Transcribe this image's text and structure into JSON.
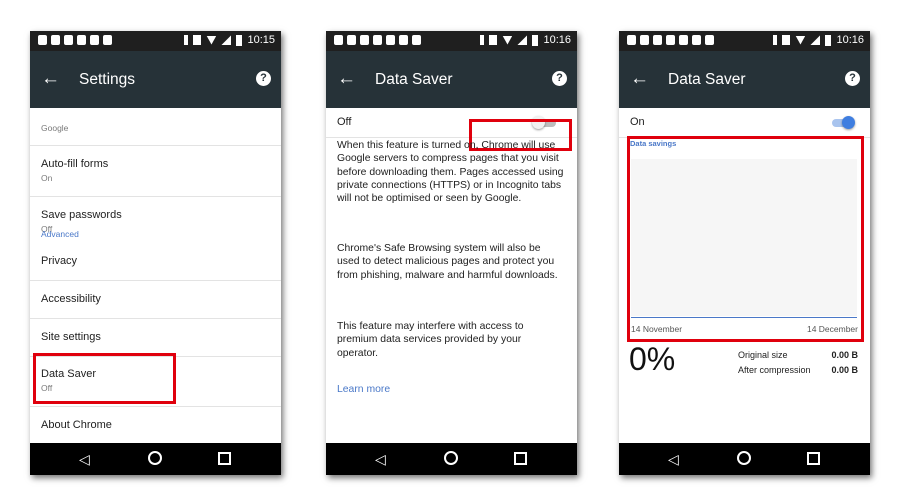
{
  "status": {
    "time1": "10:15",
    "time2": "10:16",
    "time3": "10:16"
  },
  "settings": {
    "title": "Settings",
    "partial_sub": "Google",
    "items": [
      {
        "label": "Auto-fill forms",
        "sub": "On"
      },
      {
        "label": "Save passwords",
        "sub": "Off"
      },
      {
        "label": "Privacy"
      },
      {
        "label": "Accessibility"
      },
      {
        "label": "Site settings"
      },
      {
        "label": "Data Saver",
        "sub": "Off"
      },
      {
        "label": "About Chrome"
      }
    ],
    "section": "Advanced"
  },
  "data_saver_off": {
    "title": "Data Saver",
    "toggle_label": "Off",
    "para1": "When this feature is turned on, Chrome will use Google servers to compress pages that you visit before downloading them. Pages accessed using private connections (HTTPS) or in Incognito tabs will not be optimised or seen by Google.",
    "para2": "Chrome's Safe Browsing system will also be used to detect malicious pages and protect you from phishing, malware and harmful downloads.",
    "para3": "This feature may interfere with access to premium data services provided by your operator.",
    "learn_more": "Learn more"
  },
  "data_saver_on": {
    "title": "Data Saver",
    "toggle_label": "On",
    "chart_title": "Data savings",
    "x_start": "14 November",
    "x_end": "14 December",
    "percent": "0%",
    "original_label": "Original size",
    "original_value": "0.00 B",
    "after_label": "After compression",
    "after_value": "0.00 B"
  },
  "colors": {
    "appbar": "#263238",
    "accent": "#4a78c8",
    "highlight": "#e0000d"
  },
  "icons": [
    "back-arrow-icon",
    "help-icon",
    "nav-back-icon",
    "nav-home-icon",
    "nav-recents-icon"
  ]
}
